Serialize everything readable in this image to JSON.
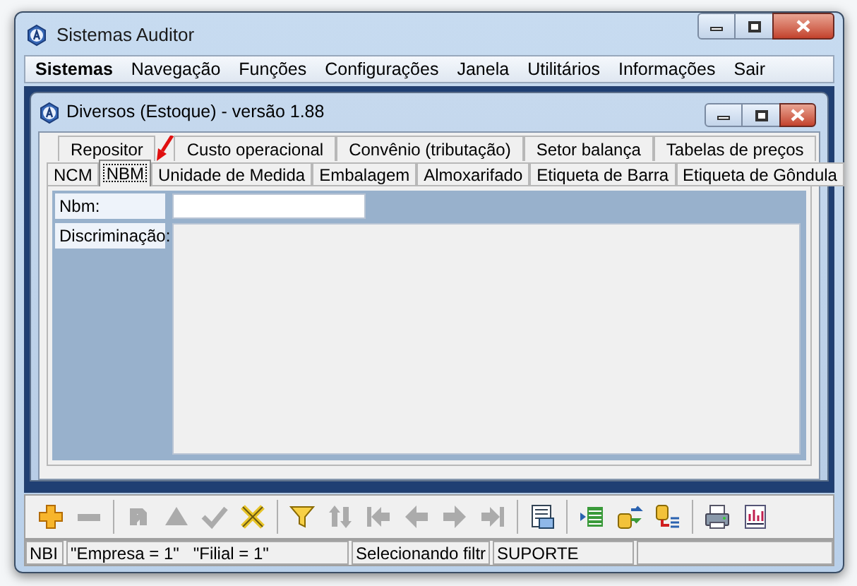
{
  "window": {
    "title": "Sistemas Auditor"
  },
  "menu": [
    {
      "label": "Sistemas",
      "selected": true
    },
    {
      "label": "Navegação",
      "selected": false
    },
    {
      "label": "Funções",
      "selected": false
    },
    {
      "label": "Configurações",
      "selected": false
    },
    {
      "label": "Janela",
      "selected": false
    },
    {
      "label": "Utilitários",
      "selected": false
    },
    {
      "label": "Informações",
      "selected": false
    },
    {
      "label": "Sair",
      "selected": false
    }
  ],
  "child_window": {
    "title": "Diversos (Estoque) - versão 1.88"
  },
  "tabs_back": [
    {
      "label": "Repositor",
      "selected": false
    },
    {
      "label": "Custo operacional",
      "selected": false
    },
    {
      "label": "Convênio (tributação)",
      "selected": false
    },
    {
      "label": "Setor balança",
      "selected": false
    },
    {
      "label": "Tabelas de preços",
      "selected": false
    }
  ],
  "tabs_front": [
    {
      "label": "NCM",
      "selected": false
    },
    {
      "label": "NBM",
      "selected": true
    },
    {
      "label": "Unidade de Medida",
      "selected": false
    },
    {
      "label": "Embalagem",
      "selected": false
    },
    {
      "label": "Almoxarifado",
      "selected": false
    },
    {
      "label": "Etiqueta de Barra",
      "selected": false
    },
    {
      "label": "Etiqueta de Gôndula",
      "selected": false
    }
  ],
  "form": {
    "nbm_label": "Nbm:",
    "discriminacao_label": "Discriminação:"
  },
  "toolbar": [
    {
      "kind": "plus",
      "disabled": false
    },
    {
      "kind": "minus",
      "disabled": true
    },
    {
      "kind": "separator",
      "disabled": false
    },
    {
      "kind": "redo",
      "disabled": true
    },
    {
      "kind": "up",
      "disabled": true
    },
    {
      "kind": "check",
      "disabled": true
    },
    {
      "kind": "cancel",
      "disabled": false
    },
    {
      "kind": "separator",
      "disabled": false
    },
    {
      "kind": "funnel",
      "disabled": false
    },
    {
      "kind": "sort",
      "disabled": true
    },
    {
      "kind": "first",
      "disabled": true
    },
    {
      "kind": "prev",
      "disabled": true
    },
    {
      "kind": "next",
      "disabled": true
    },
    {
      "kind": "last",
      "disabled": true
    },
    {
      "kind": "separator",
      "disabled": false
    },
    {
      "kind": "form",
      "disabled": false
    },
    {
      "kind": "separator",
      "disabled": false
    },
    {
      "kind": "list",
      "disabled": false
    },
    {
      "kind": "database",
      "disabled": false
    },
    {
      "kind": "dblist",
      "disabled": false
    },
    {
      "kind": "separator",
      "disabled": false
    },
    {
      "kind": "printer",
      "disabled": false
    },
    {
      "kind": "chart",
      "disabled": false
    }
  ],
  "status_bar": [
    "NBI",
    "\"Empresa = 1\"   \"Filial = 1\"",
    "Selecionando filtr",
    "SUPORTE"
  ]
}
